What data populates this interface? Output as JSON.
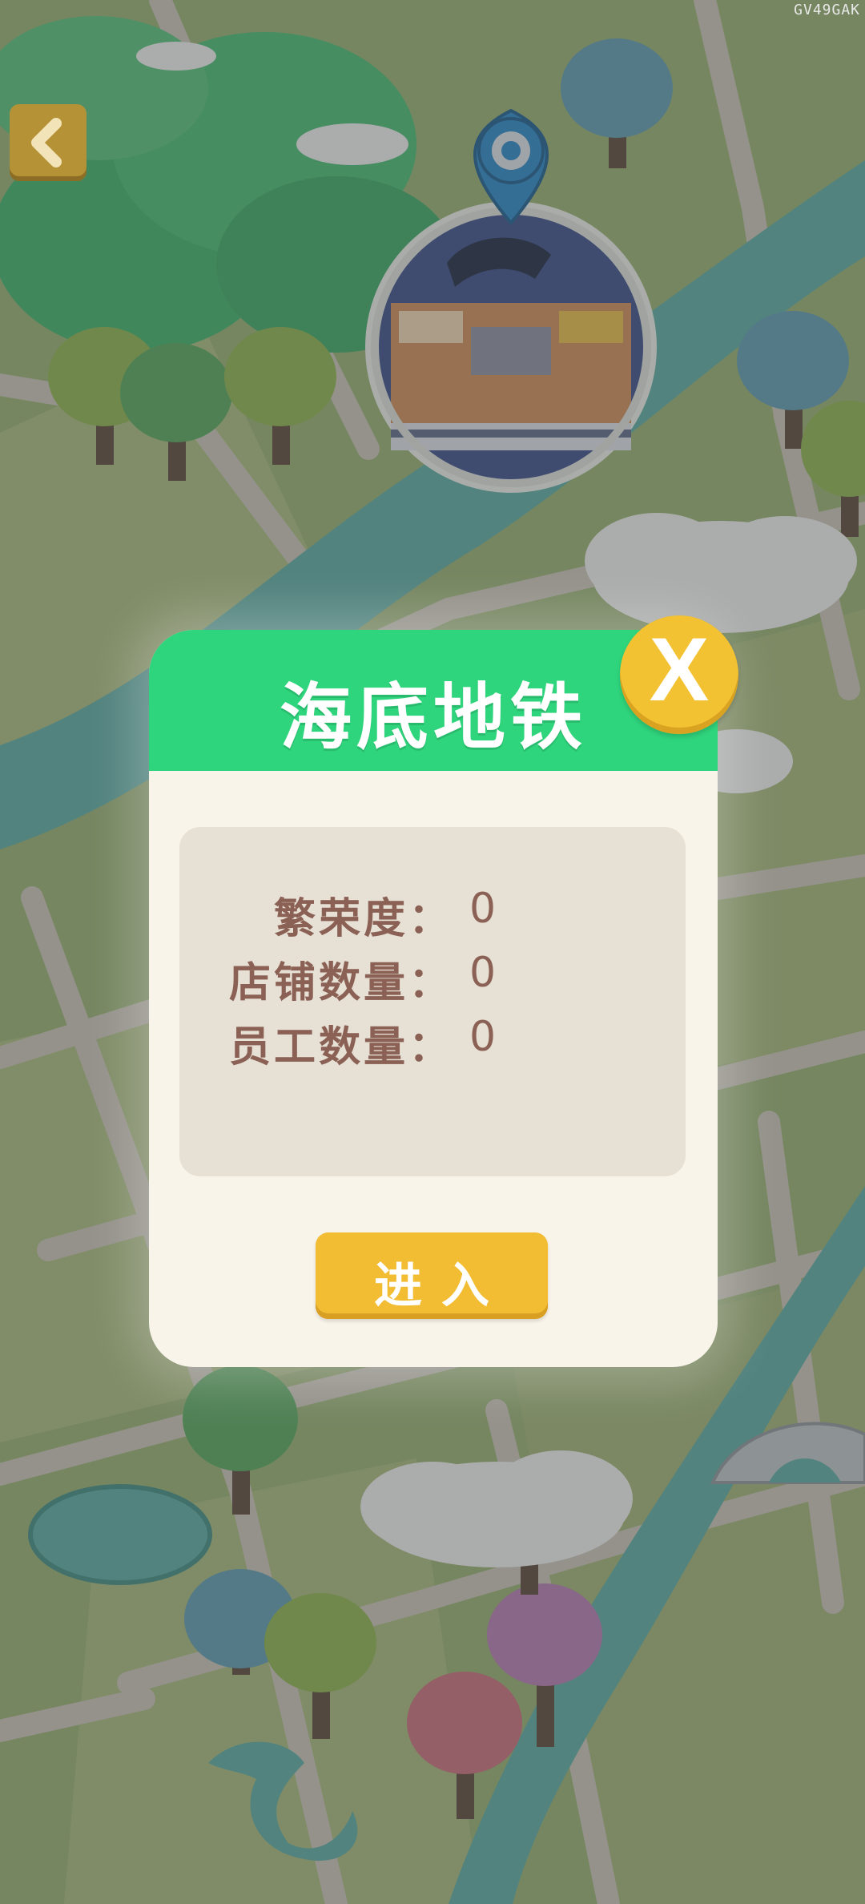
{
  "watermark": "GV49GAK",
  "map": {
    "location_name": "海底地铁"
  },
  "dialog": {
    "title": "海底地铁",
    "close_label": "X",
    "stats": [
      {
        "label": "繁荣度：",
        "value": "0"
      },
      {
        "label": "店铺数量：",
        "value": "0"
      },
      {
        "label": "员工数量：",
        "value": "0"
      }
    ],
    "enter_label": "进入"
  },
  "colors": {
    "header_green": "#2fd57d",
    "dialog_bg": "#f9f4e9",
    "panel_bg": "#e7e0d4",
    "stat_text": "#8a6154",
    "button_yellow": "#f2bd33",
    "map_green": "#8aa06a"
  },
  "icons": {
    "back": "chevron-left-icon",
    "close": "close-icon",
    "pin": "map-pin-icon"
  }
}
